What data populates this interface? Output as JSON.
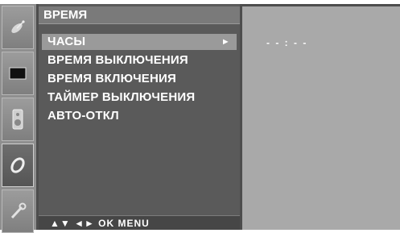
{
  "panel": {
    "title": "ВРЕМЯ",
    "items": [
      {
        "label": "ЧАСЫ",
        "selected": true,
        "arrow": "►"
      },
      {
        "label": "ВРЕМЯ ВЫКЛЮЧЕНИЯ",
        "selected": false
      },
      {
        "label": "ВРЕМЯ ВКЛЮЧЕНИЯ",
        "selected": false
      },
      {
        "label": "ТАЙМЕР ВЫКЛЮЧЕНИЯ",
        "selected": false
      },
      {
        "label": "АВТО-ОТКЛ",
        "selected": false
      }
    ],
    "footer": "▲▼ ◄► OK MENU"
  },
  "value": {
    "clock": "- - : - -"
  },
  "icons": [
    "satellite-dish-icon",
    "screen-icon",
    "speaker-icon",
    "clock-icon",
    "wrench-icon"
  ],
  "colors": {
    "panel_bg": "#5a5a5a",
    "selected_bg": "#9a9a9a",
    "value_bg": "#a9a9a9",
    "text": "#ffffff"
  }
}
